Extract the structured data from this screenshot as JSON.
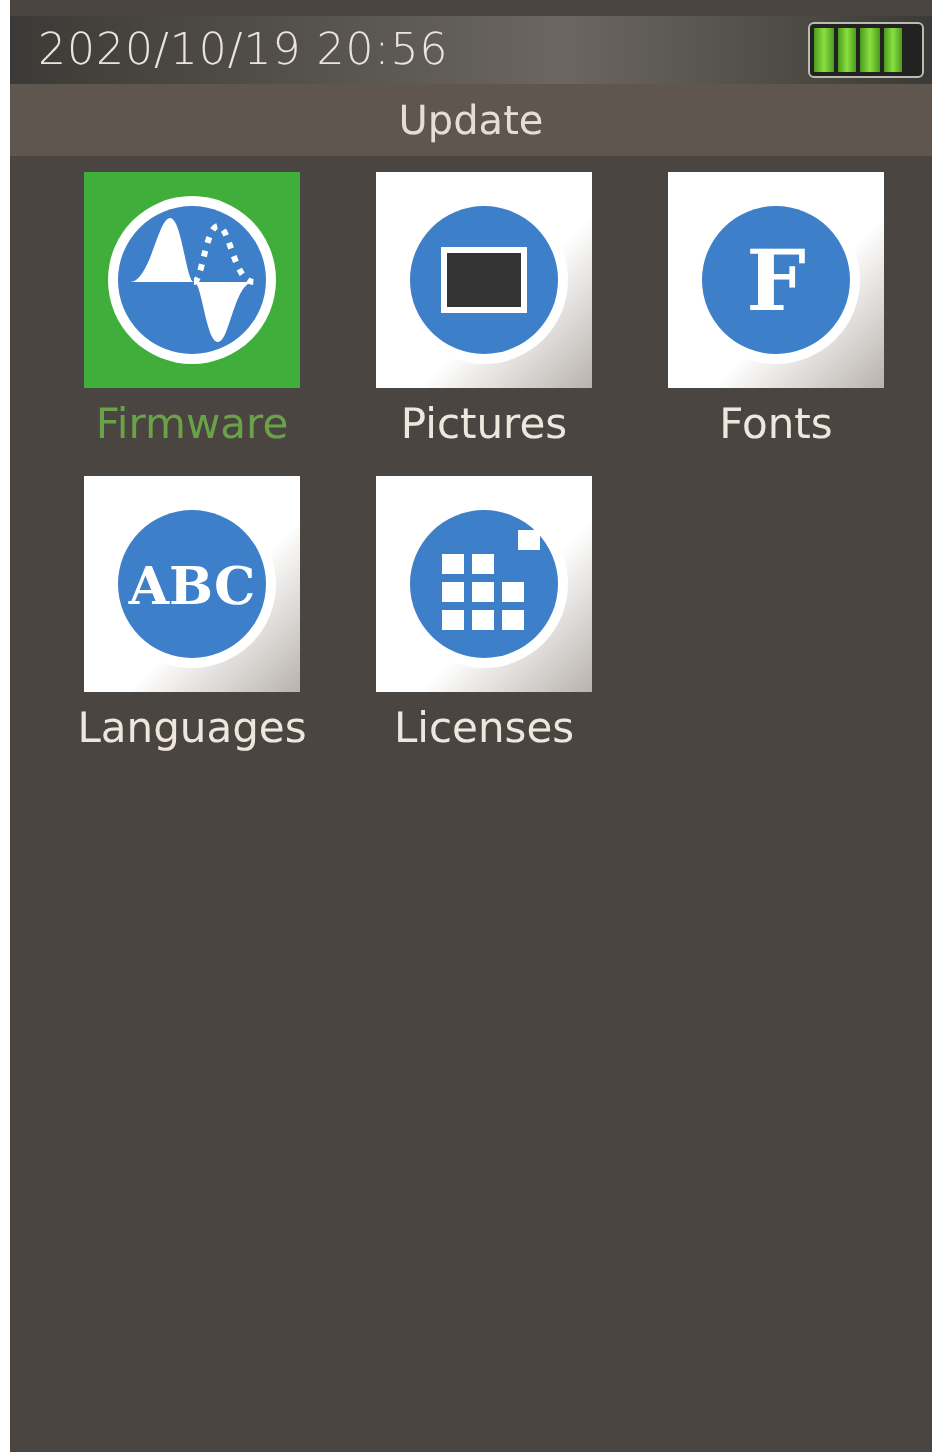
{
  "status_bar": {
    "datetime": "2020/10/19 20:56"
  },
  "title": "Update",
  "items": [
    {
      "label": "Firmware",
      "kind": "wave",
      "selected": true
    },
    {
      "label": "Pictures",
      "kind": "frame",
      "selected": false
    },
    {
      "label": "Fonts",
      "kind": "letter",
      "icon_text": "F",
      "selected": false
    },
    {
      "label": "Languages",
      "kind": "letter",
      "icon_text": "ABC",
      "selected": false
    },
    {
      "label": "Licenses",
      "kind": "grid",
      "selected": false
    }
  ]
}
